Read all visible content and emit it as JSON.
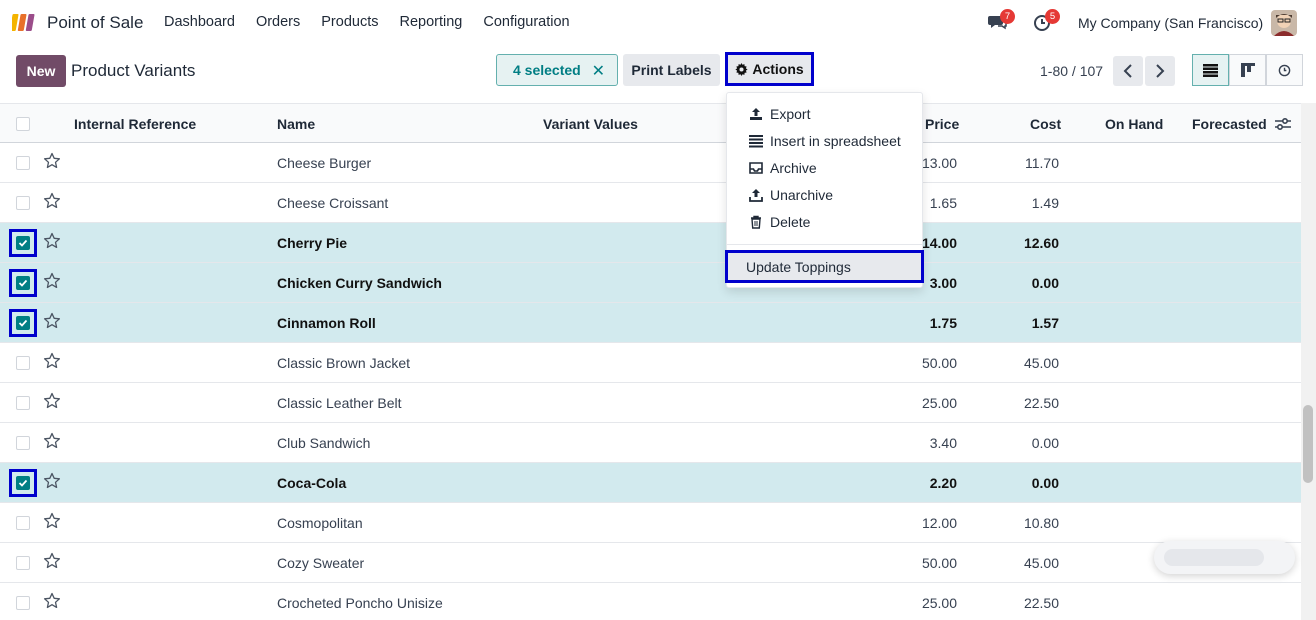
{
  "app": {
    "title": "Point of Sale"
  },
  "menu": [
    "Dashboard",
    "Orders",
    "Products",
    "Reporting",
    "Configuration"
  ],
  "navbar": {
    "messages_badge": "7",
    "activity_badge": "5",
    "company": "My Company (San Francisco)"
  },
  "control_panel": {
    "new_label": "New",
    "breadcrumb": "Product Variants",
    "selected_label": "4 selected",
    "print_labels": "Print Labels",
    "actions_label": "Actions",
    "pager": "1-80 / 107"
  },
  "actions_menu": {
    "items": [
      "Export",
      "Insert in spreadsheet",
      "Archive",
      "Unarchive",
      "Delete"
    ],
    "custom": "Update Toppings"
  },
  "table": {
    "headers": {
      "internal_reference": "Internal Reference",
      "name": "Name",
      "variant_values": "Variant Values",
      "price": "Price",
      "cost": "Cost",
      "on_hand": "On Hand",
      "forecasted": "Forecasted"
    },
    "rows": [
      {
        "name": "Cheese Burger",
        "price": "13.00",
        "cost": "11.70",
        "selected": false
      },
      {
        "name": "Cheese Croissant",
        "price": "1.65",
        "cost": "1.49",
        "selected": false
      },
      {
        "name": "Cherry Pie",
        "price": "14.00",
        "cost": "12.60",
        "selected": true
      },
      {
        "name": "Chicken Curry Sandwich",
        "price": "3.00",
        "cost": "0.00",
        "selected": true
      },
      {
        "name": "Cinnamon Roll",
        "price": "1.75",
        "cost": "1.57",
        "selected": true
      },
      {
        "name": "Classic Brown Jacket",
        "price": "50.00",
        "cost": "45.00",
        "selected": false
      },
      {
        "name": "Classic Leather Belt",
        "price": "25.00",
        "cost": "22.50",
        "selected": false
      },
      {
        "name": "Club Sandwich",
        "price": "3.40",
        "cost": "0.00",
        "selected": false
      },
      {
        "name": "Coca-Cola",
        "price": "2.20",
        "cost": "0.00",
        "selected": true
      },
      {
        "name": "Cosmopolitan",
        "price": "12.00",
        "cost": "10.80",
        "selected": false
      },
      {
        "name": "Cozy Sweater",
        "price": "50.00",
        "cost": "45.00",
        "selected": false
      },
      {
        "name": "Crocheted Poncho Unisize",
        "price": "25.00",
        "cost": "22.50",
        "selected": false
      }
    ]
  },
  "colors": {
    "brand": "#714b67",
    "accent": "#017e84",
    "highlight": "#0000cc",
    "selected_row": "#d2eaee"
  }
}
